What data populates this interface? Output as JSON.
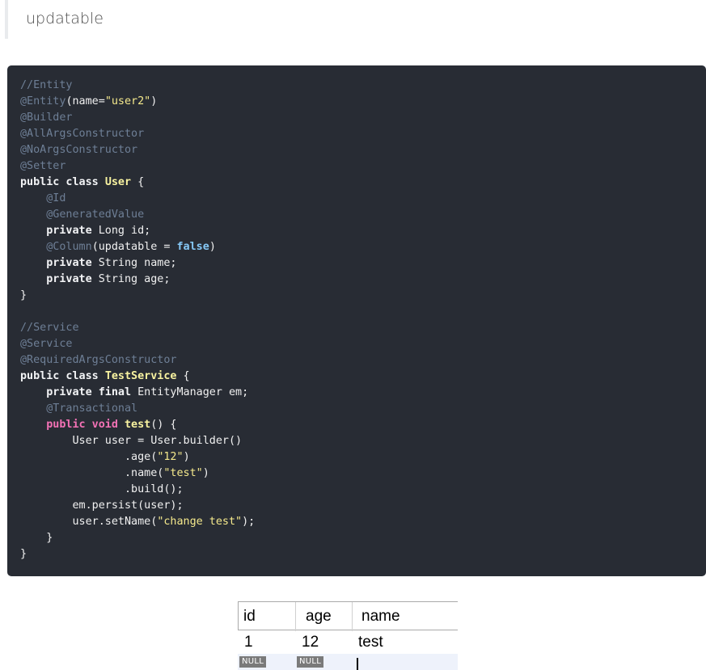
{
  "quote": {
    "text": "updatable"
  },
  "code": {
    "l1": "//Entity",
    "l2_ann": "@Entity",
    "l2_open": "(name=",
    "l2_str": "\"user2\"",
    "l2_close": ")",
    "l3": "@Builder",
    "l4": "@AllArgsConstructor",
    "l5": "@NoArgsConstructor",
    "l6": "@Setter",
    "l7_kw": "public class",
    "l7_type": "User",
    "l7_rest": " {",
    "l8": "@Id",
    "l9": "@GeneratedValue",
    "l10_kw": "private",
    "l10_rest": " Long id;",
    "l11_ann": "@Column",
    "l11_mid": "(updatable = ",
    "l11_bool": "false",
    "l11_close": ")",
    "l12_kw": "private",
    "l12_rest": " String name;",
    "l13_kw": "private",
    "l13_rest": " String age;",
    "l14": "}",
    "l16": "//Service",
    "l17": "@Service",
    "l18": "@RequiredArgsConstructor",
    "l19_kw": "public class",
    "l19_type": "TestService",
    "l19_rest": " {",
    "l20_kw": "private final",
    "l20_rest": " EntityManager em;",
    "l21": "@Transactional",
    "l22_kw": "public void",
    "l22_name": "test",
    "l22_rest": "() {",
    "l23": "User user = User.builder()",
    "l24_pre": ".age(",
    "l24_str": "\"12\"",
    "l24_post": ")",
    "l25_pre": ".name(",
    "l25_str": "\"test\"",
    "l25_post": ")",
    "l26": ".build();",
    "l27": "em.persist(user);",
    "l28_pre": "user.setName(",
    "l28_str": "\"change test\"",
    "l28_post": ");",
    "l29": "}",
    "l30": "}"
  },
  "result_table": {
    "columns": [
      "id",
      "age",
      "name"
    ],
    "row1": [
      "1",
      "12",
      "test"
    ],
    "row2": [
      "NULL",
      "NULL",
      ""
    ]
  }
}
